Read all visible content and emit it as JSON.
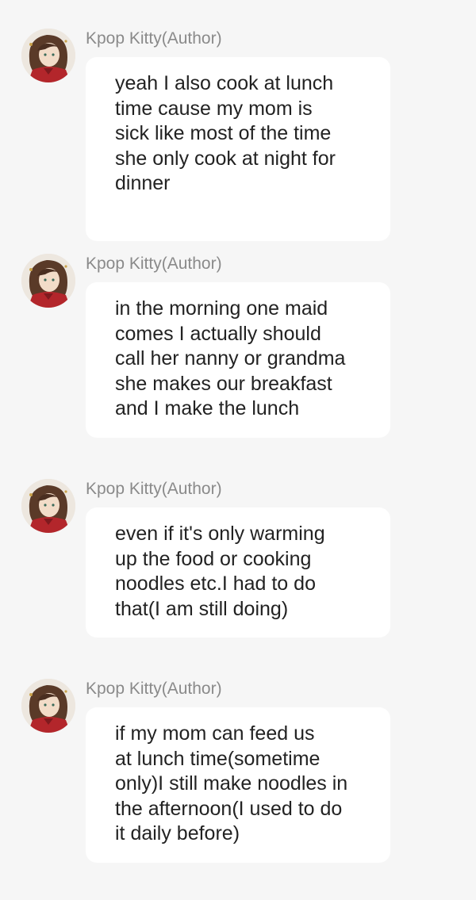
{
  "messages": [
    {
      "author": "Kpop Kitty(Author)",
      "avatar_icon": "user-avatar-icon",
      "text": "yeah I also cook at lunch\ntime cause my mom is\nsick like most of the time\nshe only cook at night for\ndinner"
    },
    {
      "author": "Kpop Kitty(Author)",
      "avatar_icon": "user-avatar-icon",
      "text": "in the morning one maid\ncomes I actually should\ncall her nanny or grandma\nshe makes our breakfast\nand I make the lunch"
    },
    {
      "author": "Kpop Kitty(Author)",
      "avatar_icon": "user-avatar-icon",
      "text": "even if it's only warming\nup the food or cooking\nnoodles etc.I had to do\nthat(I am still doing)"
    },
    {
      "author": "Kpop Kitty(Author)",
      "avatar_icon": "user-avatar-icon",
      "text": "if my mom can feed us\nat lunch time(sometime\nonly)I still make noodles in\nthe afternoon(I used to do\nit daily before)"
    }
  ],
  "colors": {
    "background": "#f6f6f6",
    "bubble": "#ffffff",
    "author_text": "#8a8a8a",
    "message_text": "#222222",
    "avatar_accent": "#b3262b"
  }
}
